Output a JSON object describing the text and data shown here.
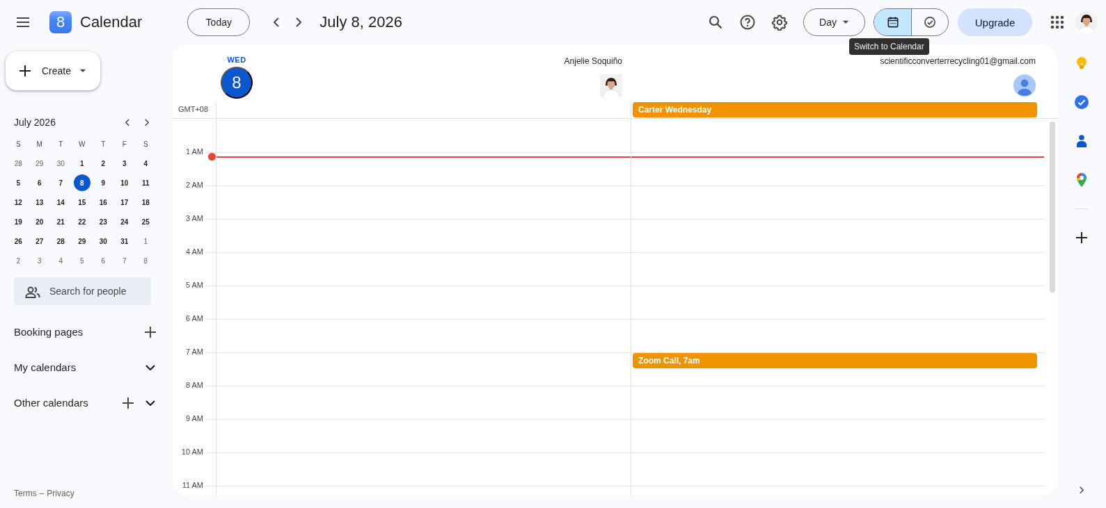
{
  "header": {
    "logo_text": "8",
    "app_title": "Calendar",
    "today_button": "Today",
    "date_title": "July 8, 2026",
    "view_dropdown": "Day",
    "view_toggle": [
      {
        "kind": "calendar",
        "selected": true
      },
      {
        "kind": "tasks",
        "selected": false
      }
    ],
    "upgrade_button": "Upgrade"
  },
  "tooltip": "Switch to Calendar",
  "sidebar": {
    "create_button": "Create",
    "mini_calendar": {
      "title": "July 2026",
      "weekdays": [
        "S",
        "M",
        "T",
        "W",
        "T",
        "F",
        "S"
      ],
      "weeks": [
        [
          {
            "d": "28",
            "in_month": false,
            "selected": false
          },
          {
            "d": "29",
            "in_month": false,
            "selected": false
          },
          {
            "d": "30",
            "in_month": false,
            "selected": false
          },
          {
            "d": "1",
            "in_month": true,
            "selected": false
          },
          {
            "d": "2",
            "in_month": true,
            "selected": false
          },
          {
            "d": "3",
            "in_month": true,
            "selected": false
          },
          {
            "d": "4",
            "in_month": true,
            "selected": false
          }
        ],
        [
          {
            "d": "5",
            "in_month": true,
            "selected": false
          },
          {
            "d": "6",
            "in_month": true,
            "selected": false
          },
          {
            "d": "7",
            "in_month": true,
            "selected": false
          },
          {
            "d": "8",
            "in_month": true,
            "selected": true
          },
          {
            "d": "9",
            "in_month": true,
            "selected": false
          },
          {
            "d": "10",
            "in_month": true,
            "selected": false
          },
          {
            "d": "11",
            "in_month": true,
            "selected": false
          }
        ],
        [
          {
            "d": "12",
            "in_month": true,
            "selected": false
          },
          {
            "d": "13",
            "in_month": true,
            "selected": false
          },
          {
            "d": "14",
            "in_month": true,
            "selected": false
          },
          {
            "d": "15",
            "in_month": true,
            "selected": false
          },
          {
            "d": "16",
            "in_month": true,
            "selected": false
          },
          {
            "d": "17",
            "in_month": true,
            "selected": false
          },
          {
            "d": "18",
            "in_month": true,
            "selected": false
          }
        ],
        [
          {
            "d": "19",
            "in_month": true,
            "selected": false
          },
          {
            "d": "20",
            "in_month": true,
            "selected": false
          },
          {
            "d": "21",
            "in_month": true,
            "selected": false
          },
          {
            "d": "22",
            "in_month": true,
            "selected": false
          },
          {
            "d": "23",
            "in_month": true,
            "selected": false
          },
          {
            "d": "24",
            "in_month": true,
            "selected": false
          },
          {
            "d": "25",
            "in_month": true,
            "selected": false
          }
        ],
        [
          {
            "d": "26",
            "in_month": true,
            "selected": false
          },
          {
            "d": "27",
            "in_month": true,
            "selected": false
          },
          {
            "d": "28",
            "in_month": true,
            "selected": false
          },
          {
            "d": "29",
            "in_month": true,
            "selected": false
          },
          {
            "d": "30",
            "in_month": true,
            "selected": false
          },
          {
            "d": "31",
            "in_month": true,
            "selected": false
          },
          {
            "d": "1",
            "in_month": false,
            "selected": false
          }
        ],
        [
          {
            "d": "2",
            "in_month": false,
            "selected": false
          },
          {
            "d": "3",
            "in_month": false,
            "selected": false
          },
          {
            "d": "4",
            "in_month": false,
            "selected": false
          },
          {
            "d": "5",
            "in_month": false,
            "selected": false
          },
          {
            "d": "6",
            "in_month": false,
            "selected": false
          },
          {
            "d": "7",
            "in_month": false,
            "selected": false
          },
          {
            "d": "8",
            "in_month": false,
            "selected": false
          }
        ]
      ]
    },
    "search_people": {
      "placeholder": "Search for people"
    },
    "sections": [
      {
        "label": "Booking pages",
        "add": true,
        "expandable": false
      },
      {
        "label": "My calendars",
        "add": false,
        "expandable": true
      },
      {
        "label": "Other calendars",
        "add": true,
        "expandable": true
      }
    ],
    "footer": {
      "terms": "Terms",
      "separator": "–",
      "privacy": "Privacy"
    }
  },
  "day_view": {
    "weekday": "WED",
    "day": "8",
    "timezone": "GMT+08",
    "columns": [
      {
        "name": "Anjelie Soquiño"
      },
      {
        "name": "scientificconverterrecycling01@gmail.com",
        "kind": "generic",
        "all_day_events": [
          "Carter Wednesday"
        ]
      }
    ],
    "hours": [
      {
        "label": "1 AM",
        "now_line": true
      },
      {
        "label": "2 AM"
      },
      {
        "label": "3 AM"
      },
      {
        "label": "4 AM"
      },
      {
        "label": "5 AM"
      },
      {
        "label": "6 AM"
      },
      {
        "label": "7 AM",
        "events": [
          {
            "title": "Zoom Call, 7am",
            "kind": "account"
          }
        ]
      },
      {
        "label": "8 AM"
      },
      {
        "label": "9 AM"
      },
      {
        "label": "10 AM"
      },
      {
        "label": "11 AM"
      }
    ]
  }
}
